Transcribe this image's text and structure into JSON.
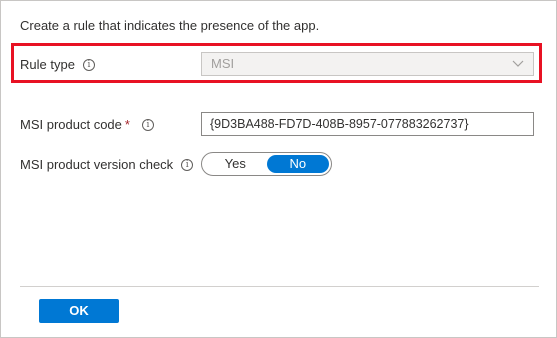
{
  "intro_text": "Create a rule that indicates the presence of the app.",
  "rule_type": {
    "label": "Rule type",
    "info_icon": "info-icon",
    "selected_value": "MSI",
    "dropdown_icon": "chevron-down-icon",
    "disabled": true,
    "highlight_color": "#e81123"
  },
  "msi_product_code": {
    "label": "MSI product code",
    "required_marker": "*",
    "info_icon": "info-icon",
    "value": "{9D3BA488-FD7D-408B-8957-077883262737}"
  },
  "msi_version_check": {
    "label": "MSI product version check",
    "info_icon": "info-icon",
    "options": [
      "Yes",
      "No"
    ],
    "selected": "No"
  },
  "footer": {
    "ok_label": "OK"
  },
  "colors": {
    "accent": "#0078d4",
    "required": "#a4262c",
    "highlight": "#e81123"
  }
}
